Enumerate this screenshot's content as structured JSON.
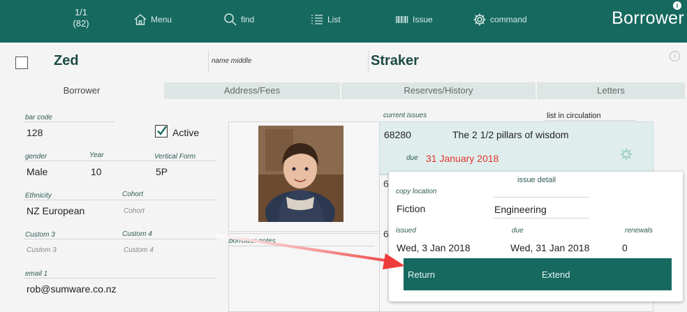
{
  "toolbar": {
    "record_index": "1/1",
    "record_total": "(82)",
    "menu": "Menu",
    "find": "find",
    "list": "List",
    "issue": "Issue",
    "command": "command",
    "title": "Borrower",
    "bg_color": "#16695f"
  },
  "name": {
    "first": "Zed",
    "middle_placeholder": "name middle",
    "last": "Straker"
  },
  "tabs": [
    "Borrower",
    "Address/Fees",
    "Reserves/History",
    "Letters"
  ],
  "fields": {
    "bar_code_label": "bar code",
    "bar_code": "128",
    "active_label": "Active",
    "active_checked": true,
    "gender_label": "gender",
    "gender": "Male",
    "year_label": "Year",
    "year": "10",
    "form_label": "Vertical Form",
    "form": "5P",
    "ethnicity_label": "Ethnicity",
    "ethnicity": "NZ European",
    "cohort_label": "Cohort",
    "cohort_placeholder": "Cohort",
    "custom3_label": "Custom 3",
    "custom3_placeholder": "Custom 3",
    "custom4_label": "Custom 4",
    "custom4_placeholder": "Custom 4",
    "email1_label": "email 1",
    "email1": "rob@sumware.co.nz"
  },
  "notes_label": "borrower notes",
  "issues": {
    "header": "current issues",
    "list_label": "list in circulation",
    "barcode": "68280",
    "title": "The 2 1/2 pillars of wisdom",
    "due_label": "due",
    "due_date": "31 January 2018",
    "due_color": "#e0352b"
  },
  "popup": {
    "title": "issue detail",
    "copy_location_label": "copy location",
    "copy_location": "Fiction",
    "subject": "Engineering",
    "issued_label": "issued",
    "issued": "Wed, 3 Jan 2018",
    "due_label": "due",
    "due": "Wed, 31 Jan 2018",
    "renewals_label": "renewals",
    "renewals": "0",
    "return_label": "Return",
    "extend_label": "Extend"
  }
}
